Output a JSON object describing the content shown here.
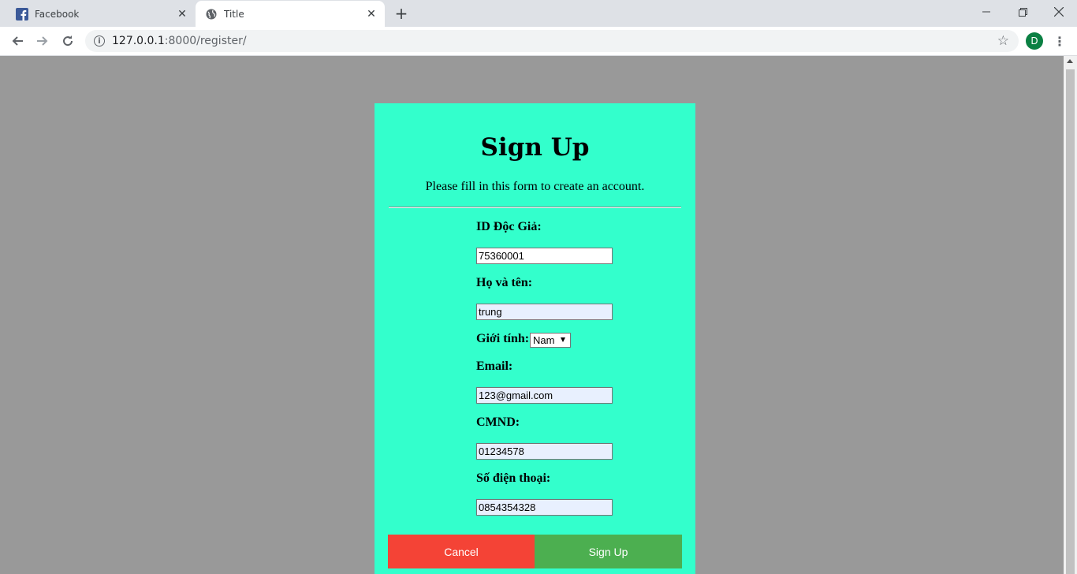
{
  "browser": {
    "tabs": [
      {
        "title": "Facebook",
        "icon": "facebook-icon",
        "active": false
      },
      {
        "title": "Title",
        "icon": "globe-icon",
        "active": true
      }
    ],
    "url_host": "127.0.0.1",
    "url_rest": ":8000/register/",
    "profile_initial": "D"
  },
  "form": {
    "heading": "Sign Up",
    "subtitle": "Please fill in this form to create an account.",
    "fields": {
      "id": {
        "label": "ID Độc Giả:",
        "value": "75360001"
      },
      "name": {
        "label": "Họ và tên:",
        "value": "trung"
      },
      "gender": {
        "label": "Giới tính:",
        "value": "Nam"
      },
      "email": {
        "label": "Email:",
        "value": "123@gmail.com"
      },
      "cmnd": {
        "label": "CMND:",
        "value": "01234578"
      },
      "phone": {
        "label": "Số điện thoại:",
        "value": "0854354328"
      }
    },
    "cancel_label": "Cancel",
    "submit_label": "Sign Up"
  },
  "colors": {
    "page_bg": "#999999",
    "card_bg": "#33ffcc",
    "cancel": "#f44336",
    "submit": "#4caf50"
  }
}
